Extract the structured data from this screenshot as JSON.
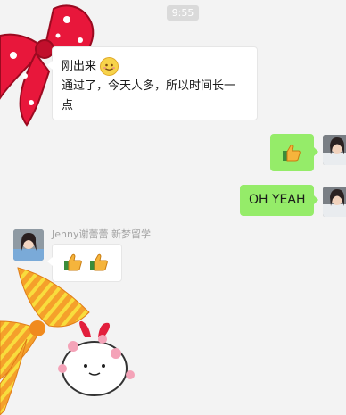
{
  "timestamp": "9:55",
  "messages": [
    {
      "side": "left",
      "line1": "刚出来",
      "line2": "通过了，今天人多，所以时间长一",
      "line3": "点"
    },
    {
      "side": "right",
      "content": "thumbs-up sticker"
    },
    {
      "side": "right",
      "text": "OH YEAH"
    },
    {
      "side": "left",
      "sender": "Jenny谢蕾蕾 新梦留学",
      "content": "two thumbs-up"
    }
  ],
  "colors": {
    "background": "#f3f3f3",
    "outgoing_bubble": "#95ec69",
    "incoming_bubble": "#ffffff",
    "timestamp_bg": "#dadada"
  }
}
